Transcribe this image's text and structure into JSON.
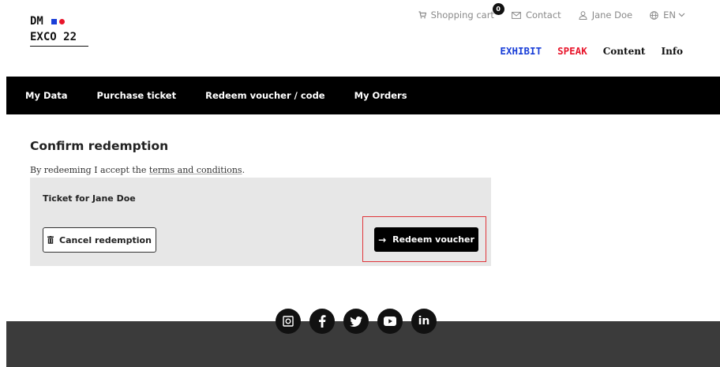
{
  "logo": {
    "line1": "DM",
    "line2": "EXCO 22"
  },
  "topnav": {
    "cart_label": "Shopping cart",
    "cart_count": "0",
    "contact_label": "Contact",
    "user_label": "Jane Doe",
    "language_label": "EN"
  },
  "mainnav": {
    "exhibit": "EXHIBIT",
    "speak": "SPEAK",
    "content": "Content",
    "info": "Info"
  },
  "tabs": [
    {
      "label": "My Data"
    },
    {
      "label": "Purchase ticket"
    },
    {
      "label": "Redeem voucher / code"
    },
    {
      "label": "My Orders"
    }
  ],
  "main": {
    "title": "Confirm redemption",
    "accept_prefix": "By redeeming I accept the ",
    "accept_link": "terms and conditions",
    "accept_suffix": ".",
    "ticket_label": "Ticket for Jane Doe",
    "cancel_button": "Cancel redemption",
    "redeem_button": "Redeem voucher"
  },
  "footer": {
    "socials": [
      "instagram-icon",
      "facebook-icon",
      "twitter-icon",
      "youtube-icon",
      "linkedin-icon"
    ]
  },
  "colors": {
    "blue": "#1a3fd8",
    "red": "#e8152b",
    "black": "#000000",
    "panel": "#e7e7e7",
    "footer": "#3b3b3b"
  }
}
